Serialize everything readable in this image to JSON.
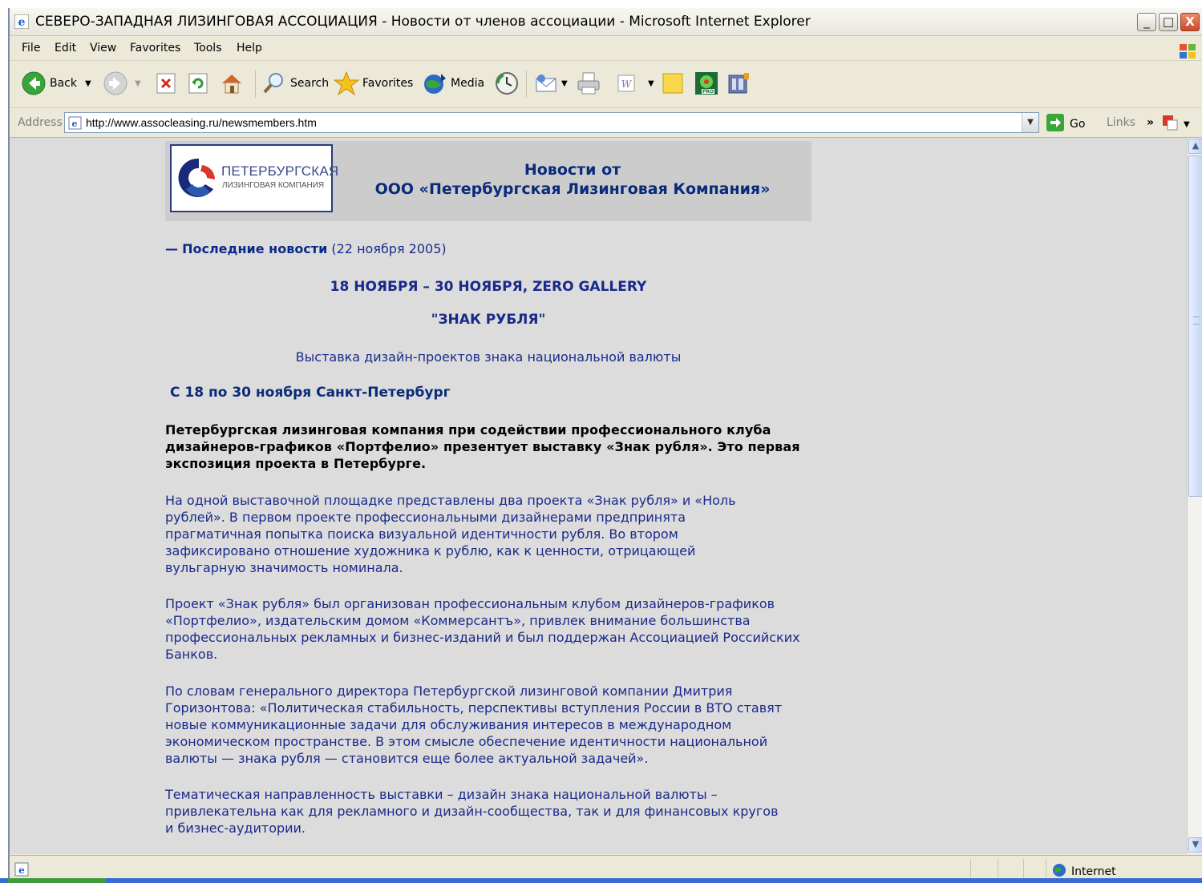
{
  "window": {
    "title": "СЕВЕРО-ЗАПАДНАЯ ЛИЗИНГОВАЯ АССОЦИАЦИЯ - Новости от членов ассоциации - Microsoft Internet Explorer",
    "minimize": "_",
    "maximize": "□",
    "close": "X"
  },
  "menu": [
    "File",
    "Edit",
    "View",
    "Favorites",
    "Tools",
    "Help"
  ],
  "toolbar": {
    "back": "Back",
    "search": "Search",
    "favorites": "Favorites",
    "media": "Media"
  },
  "address": {
    "label": "Address",
    "url": "http://www.assocleasing.ru/newsmembers.htm",
    "go": "Go",
    "links": "Links",
    "chevron": "»"
  },
  "page": {
    "logo_line1": "ПЕТЕРБУРГСКАЯ",
    "logo_line2": "ЛИЗИНГОВАЯ КОМПАНИЯ",
    "header_line1": "Новости от",
    "header_line2": "ООО «Петербургская Лизинговая Компания»",
    "news_dash": "—",
    "news_label": "Последние новости",
    "news_date": "(22 ноября 2005)",
    "event_dates": "18 НОЯБРЯ – 30 НОЯБРЯ, ZERO GALLERY",
    "event_title": "\"ЗНАК РУБЛЯ\"",
    "event_subtitle": "Выставка дизайн-проектов знака национальной валюты",
    "event_place": "С 18 по 30 ноября Санкт-Петербург",
    "lead": "Петербургская лизинговая компания при содействии профессионального клуба дизайнеров-графиков «Портфелио» презентует выставку «Знак рубля». Это первая экспозиция проекта в Петербурге.",
    "p1": "На одной выставочной площадке представлены два проекта «Знак рубля» и «Ноль рублей».  В первом проекте профессиональными дизайнерами предпринята прагматичная попытка поиска визуальной идентичности рубля. Во втором зафиксировано отношение художника к рублю, как к ценности, отрицающей вульгарную значимость номинала.",
    "p2": " Проект «Знак рубля» был организован профессиональным клубом дизайнеров-графиков «Портфелио», издательским домом «Коммерсантъ», привлек внимание большинства профессиональных рекламных и бизнес-изданий и был поддержан Ассоциацией Российских Банков.",
    "p3": " По словам генерального директора Петербургской лизинговой компании Дмитрия Горизонтова: «Политическая стабильность, перспективы вступления России в ВТО ставят новые коммуникационные задачи для обслуживания интересов в международном экономическом пространстве. В этом смысле обеспечение идентичности национальной валюты — знака рубля — становится еще более актуальной задачей».",
    "p4": " Тематическая направленность выставки – дизайн знака национальной валюты – привлекательна как для рекламного и дизайн-сообщества, так и для финансовых кругов и бизнес-аудитории."
  },
  "status": {
    "zone": "Internet"
  }
}
